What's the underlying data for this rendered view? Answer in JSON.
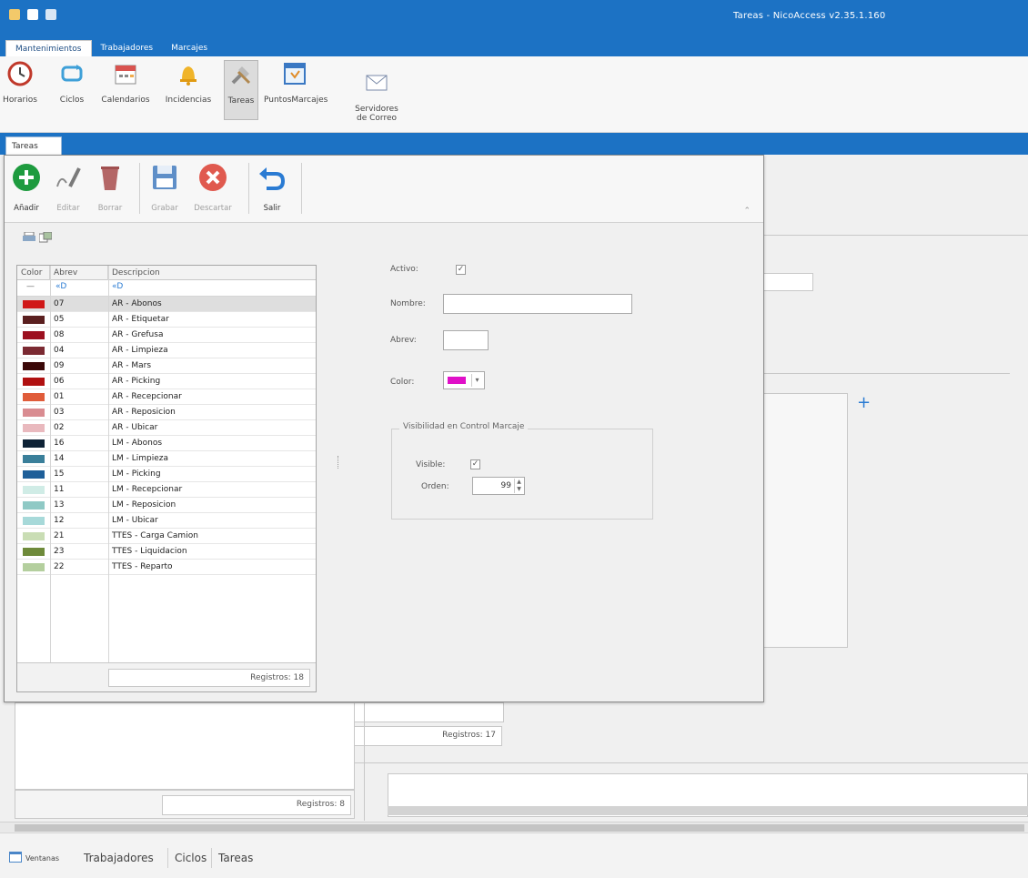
{
  "app": {
    "title": "Tareas - NicoAccess v2.35.1.160",
    "ribbon_tabs": [
      "Mantenimientos",
      "Trabajadores",
      "Marcajes"
    ],
    "ribbon_buttons": [
      "Horarios",
      "Ciclos",
      "Calendarios",
      "Incidencias",
      "Tareas",
      "PuntosMarcajes",
      "Servidores\nde Correo"
    ]
  },
  "doc": {
    "tab_label": "Tareas"
  },
  "toolbar": {
    "add": "Añadir",
    "edit": "Editar",
    "delete": "Borrar",
    "save": "Grabar",
    "discard": "Descartar",
    "exit": "Salir"
  },
  "grid": {
    "headers": [
      "Color",
      "Abrev",
      "Descripcion"
    ],
    "filter_marks": [
      "—",
      "«D",
      "«D"
    ],
    "rows": [
      {
        "color": "#d01818",
        "abrev": "07",
        "desc": "AR - Abonos",
        "selected": true
      },
      {
        "color": "#5a1f1f",
        "abrev": "05",
        "desc": "AR - Etiquetar"
      },
      {
        "color": "#9c1020",
        "abrev": "08",
        "desc": "AR - Grefusa"
      },
      {
        "color": "#7b2a32",
        "abrev": "04",
        "desc": "AR - Limpieza"
      },
      {
        "color": "#3b0808",
        "abrev": "09",
        "desc": "AR - Mars"
      },
      {
        "color": "#b01010",
        "abrev": "06",
        "desc": "AR - Picking"
      },
      {
        "color": "#e05c3a",
        "abrev": "01",
        "desc": "AR - Recepcionar"
      },
      {
        "color": "#d98c91",
        "abrev": "03",
        "desc": "AR - Reposicion"
      },
      {
        "color": "#e9b9be",
        "abrev": "02",
        "desc": "AR - Ubicar"
      },
      {
        "color": "#0e2236",
        "abrev": "16",
        "desc": "LM - Abonos"
      },
      {
        "color": "#3a7f9a",
        "abrev": "14",
        "desc": "LM - Limpieza"
      },
      {
        "color": "#1e5f99",
        "abrev": "15",
        "desc": "LM - Picking"
      },
      {
        "color": "#d0ece6",
        "abrev": "11",
        "desc": "LM - Recepcionar"
      },
      {
        "color": "#8fc9c5",
        "abrev": "13",
        "desc": "LM - Reposicion"
      },
      {
        "color": "#a7d9d9",
        "abrev": "12",
        "desc": "LM - Ubicar"
      },
      {
        "color": "#c9ddb4",
        "abrev": "21",
        "desc": "TTES - Carga Camion"
      },
      {
        "color": "#6e8a3a",
        "abrev": "23",
        "desc": "TTES - Liquidacion"
      },
      {
        "color": "#b4cf9e",
        "abrev": "22",
        "desc": "TTES - Reparto"
      }
    ],
    "footer": "Registros: 18"
  },
  "form": {
    "activo_label": "Activo:",
    "activo_checked": true,
    "nombre_label": "Nombre:",
    "nombre_value": "",
    "abrev_label": "Abrev:",
    "abrev_value": "",
    "color_label": "Color:",
    "color_value": "#e010c8",
    "group_title": "Visibilidad en Control Marcaje",
    "visible_label": "Visible:",
    "visible_checked": true,
    "orden_label": "Orden:",
    "orden_value": "99"
  },
  "background": {
    "reg_17": "Registros: 17",
    "reg_8": "Registros: 8"
  },
  "bottom_tabs": [
    "Ventanas",
    "Trabajadores",
    "Ciclos",
    "Tareas"
  ],
  "colors": {
    "brand_blue": "#1c72c4"
  }
}
